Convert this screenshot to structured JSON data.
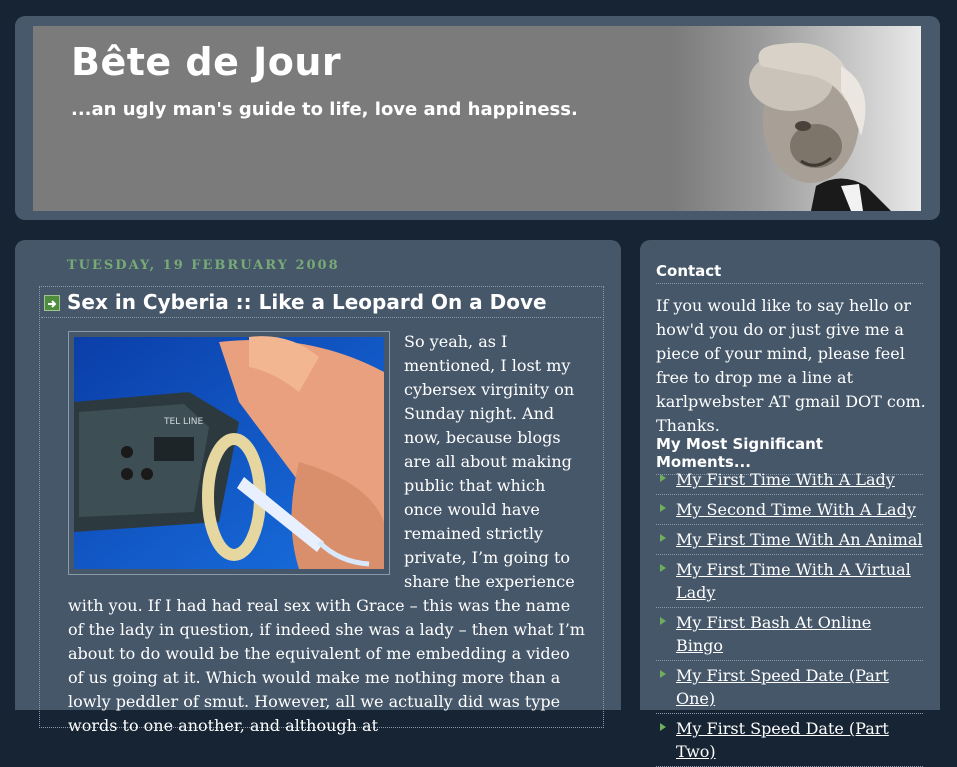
{
  "header": {
    "title": "Bête de Jour",
    "description": "...an ugly man's guide to life, love and happiness."
  },
  "post": {
    "date": "TUESDAY, 19 FEBRUARY 2008",
    "title": "Sex in Cyberia :: Like a Leopard On a Dove",
    "image_label": "TEL LINE",
    "body": "So yeah, as I mentioned, I lost my cybersex virginity on Sunday night. And now, because blogs are all about making public that which once would have remained strictly private, I’m going to share the experience with you. If I had had real sex with Grace – this was the name of the lady in question, if indeed she was a lady – then what I’m about to do would be the equivalent of me embedding a video of us going at it. Which would make me nothing more than a lowly peddler of smut. However, all we actually did was type words to one another, and although at"
  },
  "sidebar": {
    "contact_heading": "Contact",
    "contact_text": "If you would like to say hello or how'd you do or just give me a piece of your mind, please feel free to drop me a line at karlpwebster AT gmail DOT com. Thanks.",
    "moments_heading": "My Most Significant Moments...",
    "moments": [
      "My First Time With A Lady",
      "My Second Time With A Lady",
      "My First Time With An Animal",
      "My First Time With A Virtual Lady",
      "My First Bash At Online Bingo",
      "My First Speed Date (Part One)",
      "My First Speed Date (Part Two)"
    ]
  },
  "colors": {
    "page_background": "#162434",
    "panel_background": "#46576a",
    "date_color": "#77aa77",
    "bullet_color": "#6fae5c",
    "text": "#ffffff"
  }
}
